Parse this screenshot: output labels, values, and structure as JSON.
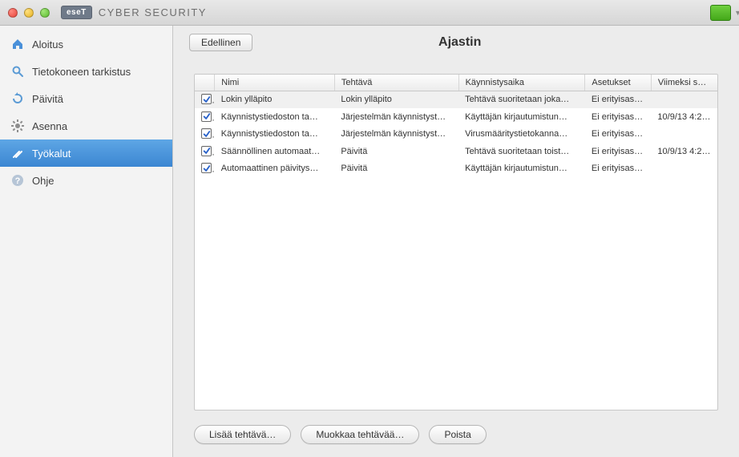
{
  "brand": {
    "badge": "eseT",
    "name": "CYBER SECURITY"
  },
  "sidebar": {
    "items": [
      {
        "label": "Aloitus"
      },
      {
        "label": "Tietokoneen tarkistus"
      },
      {
        "label": "Päivitä"
      },
      {
        "label": "Asenna"
      },
      {
        "label": "Työkalut"
      },
      {
        "label": "Ohje"
      }
    ]
  },
  "header": {
    "back": "Edellinen",
    "title": "Ajastin"
  },
  "table": {
    "columns": {
      "name": "Nimi",
      "task": "Tehtävä",
      "start": "Käynnistysaika",
      "settings": "Asetukset",
      "last": "Viimeksi su…"
    },
    "rows": [
      {
        "checked": true,
        "selected": true,
        "name": "Lokin ylläpito",
        "task": "Lokin ylläpito",
        "start": "Tehtävä suoritetaan joka…",
        "settings": "Ei erityisase…",
        "last": ""
      },
      {
        "checked": true,
        "selected": false,
        "name": "Käynnistystiedoston ta…",
        "task": "Järjestelmän käynnistyst…",
        "start": "Käyttäjän kirjautumistun…",
        "settings": "Ei erityisase…",
        "last": "10/9/13 4:2…"
      },
      {
        "checked": true,
        "selected": false,
        "name": "Käynnistystiedoston ta…",
        "task": "Järjestelmän käynnistyst…",
        "start": "Virusmääritystietokanna…",
        "settings": "Ei erityisase…",
        "last": ""
      },
      {
        "checked": true,
        "selected": false,
        "name": "Säännöllinen automaat…",
        "task": "Päivitä",
        "start": "Tehtävä suoritetaan toist…",
        "settings": "Ei erityisase…",
        "last": "10/9/13 4:2…"
      },
      {
        "checked": true,
        "selected": false,
        "name": "Automaattinen päivitys…",
        "task": "Päivitä",
        "start": "Käyttäjän kirjautumistun…",
        "settings": "Ei erityisase…",
        "last": ""
      }
    ]
  },
  "buttons": {
    "add": "Lisää tehtävä…",
    "edit": "Muokkaa tehtävää…",
    "delete": "Poista"
  }
}
